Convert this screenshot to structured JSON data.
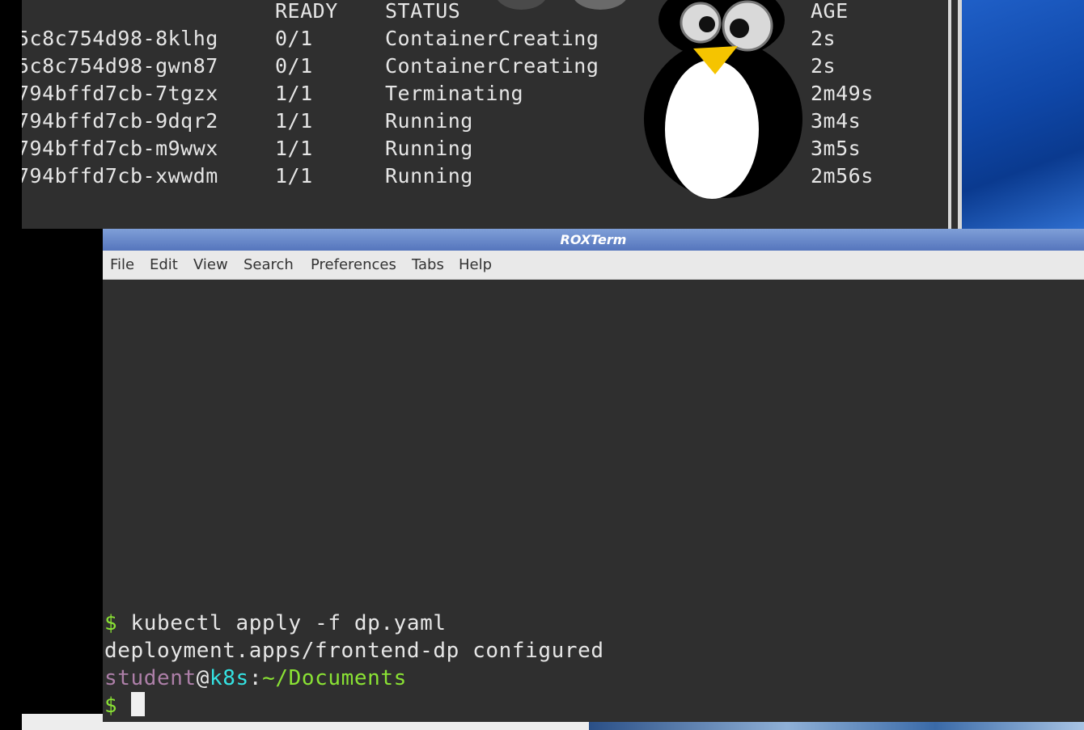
{
  "background_terminal": {
    "header": {
      "ready": "READY",
      "status": "STATUS",
      "age": "AGE"
    },
    "rows": [
      {
        "name": "5c8c754d98-8klhg",
        "ready": "0/1",
        "status": "ContainerCreating",
        "age": "2s"
      },
      {
        "name": "5c8c754d98-gwn87",
        "ready": "0/1",
        "status": "ContainerCreating",
        "age": "2s"
      },
      {
        "name": "794bffd7cb-7tgzx",
        "ready": "1/1",
        "status": "Terminating",
        "age": "2m49s"
      },
      {
        "name": "794bffd7cb-9dqr2",
        "ready": "1/1",
        "status": "Running",
        "age": "3m4s"
      },
      {
        "name": "794bffd7cb-m9wwx",
        "ready": "1/1",
        "status": "Running",
        "age": "3m5s"
      },
      {
        "name": "794bffd7cb-xwwdm",
        "ready": "1/1",
        "status": "Running",
        "age": "2m56s"
      }
    ]
  },
  "roxterm": {
    "title": "ROXTerm",
    "menu": [
      "File",
      "Edit",
      "View",
      "Search",
      "Preferences",
      "Tabs",
      "Help"
    ],
    "lines": {
      "command_prompt": "$",
      "command": " kubectl apply -f dp.yaml",
      "output": "deployment.apps/frontend-dp configured",
      "user": "student",
      "at": "@",
      "host": "k8s",
      "colon": ":",
      "path": "~/Documents",
      "final_prompt": "$ "
    }
  },
  "colors": {
    "terminal_bg": "#2f2f2f",
    "prompt_green": "#8ae234",
    "user_purple": "#ad7fa8",
    "host_cyan": "#34e2e2",
    "titlebar_blue": "#5575bd"
  }
}
